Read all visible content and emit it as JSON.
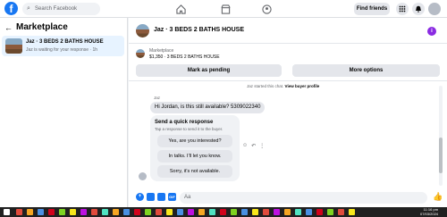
{
  "topbar": {
    "logo": "f",
    "search_placeholder": "Search Facebook",
    "find_friends": "Find friends"
  },
  "sidebar": {
    "title": "Marketplace",
    "conversation": {
      "title": "Jaz · 3 BEDS 2 BATHS HOUSE",
      "subtitle": "Jaz is waiting for your response · 1h"
    }
  },
  "chat": {
    "header_title": "Jaz · 3 BEDS 2 BATHS HOUSE",
    "info_icon": "i",
    "listing": {
      "label": "Marketplace",
      "detail": "$1,350 · 3 BEDS 2 BATHS HOUSE",
      "mark_pending": "Mark as pending",
      "more_options": "More options"
    },
    "system_note_prefix": "Jaz started this chat.",
    "system_note_link": "View buyer profile",
    "sender": "Jaz",
    "message": "Hi Jordan, is this still available? 5309022340",
    "quick_response": {
      "title": "Send a quick response",
      "subtitle": "Tap a response to send it to the buyer.",
      "options": [
        "Yes, are you interested?",
        "In talks. I'll let you know.",
        "Sorry, it's not available."
      ]
    },
    "composer_placeholder": "Aa"
  },
  "taskbar": {
    "time": "11:16 pm",
    "date": "07/03/2024"
  },
  "colors": {
    "brand": "#1877f2",
    "selected": "#e7f3ff",
    "info": "#8a2be2"
  }
}
